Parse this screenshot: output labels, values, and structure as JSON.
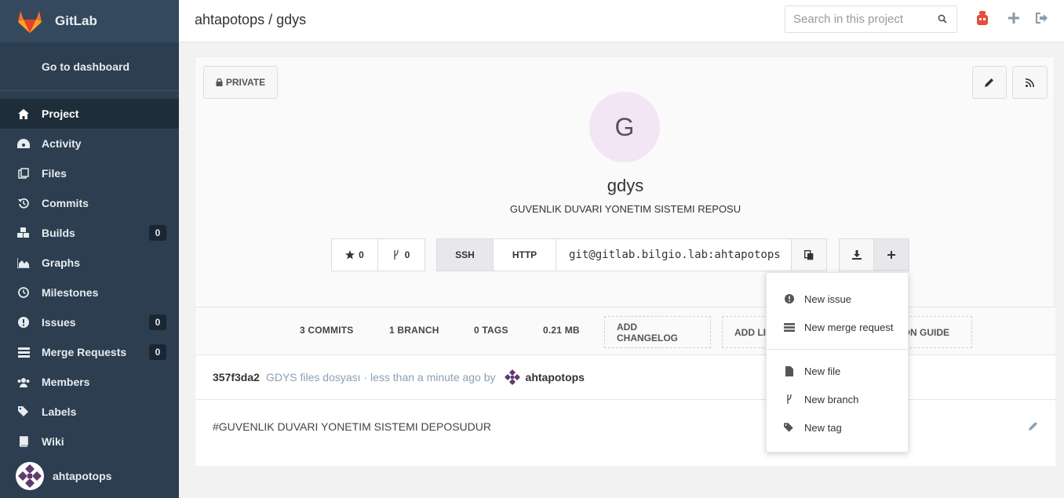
{
  "colors": {
    "sidebar": "#2c3e50",
    "sidebar_header": "#34495e",
    "active_nav": "#1f2d3a",
    "gitlab_orange": "#e24329",
    "header_icon_red": "#e74c3c",
    "avatar_bg": "#f3e5f5"
  },
  "app": {
    "brand": "GitLab",
    "dashboard_link": "Go to dashboard"
  },
  "sidebar": {
    "items": [
      {
        "label": "Project",
        "icon": "home-icon"
      },
      {
        "label": "Activity",
        "icon": "dashboard-icon"
      },
      {
        "label": "Files",
        "icon": "files-icon"
      },
      {
        "label": "Commits",
        "icon": "history-icon"
      },
      {
        "label": "Builds",
        "icon": "cubes-icon",
        "badge": "0"
      },
      {
        "label": "Graphs",
        "icon": "area-chart-icon"
      },
      {
        "label": "Milestones",
        "icon": "clock-icon"
      },
      {
        "label": "Issues",
        "icon": "exclamation-circle-icon",
        "badge": "0"
      },
      {
        "label": "Merge Requests",
        "icon": "tasks-icon",
        "badge": "0"
      },
      {
        "label": "Members",
        "icon": "users-icon"
      },
      {
        "label": "Labels",
        "icon": "tags-icon"
      },
      {
        "label": "Wiki",
        "icon": "book-icon"
      }
    ],
    "user": "ahtapotops"
  },
  "header": {
    "breadcrumb": "ahtapotops / gdys",
    "search_placeholder": "Search in this project"
  },
  "project": {
    "visibility": "PRIVATE",
    "avatar_letter": "G",
    "name": "gdys",
    "description": "GUVENLIK DUVARI YONETIM SISTEMI REPOSU",
    "stars": "0",
    "forks": "0",
    "ssh_label": "SSH",
    "http_label": "HTTP",
    "clone_url": "git@gitlab.bilgio.lab:ahtapotops"
  },
  "stats": {
    "commits": "3 COMMITS",
    "branches": "1 BRANCH",
    "tags": "0 TAGS",
    "size": "0.21 MB",
    "changelog": "ADD CHANGELOG",
    "license": "ADD LI",
    "contrib": "TION GUIDE"
  },
  "last_commit": {
    "sha": "357f3da2",
    "message": "GDYS files dosyası · less than a minute ago by",
    "author": "ahtapotops"
  },
  "readme": "#GUVENLIK DUVARI YONETIM SISTEMI DEPOSUDUR",
  "dropdown": {
    "items": [
      {
        "label": "New issue",
        "icon": "exclamation-circle-icon"
      },
      {
        "label": "New merge request",
        "icon": "tasks-icon"
      },
      {
        "label": "New file",
        "icon": "file-icon"
      },
      {
        "label": "New branch",
        "icon": "code-fork-icon"
      },
      {
        "label": "New tag",
        "icon": "tags-icon"
      }
    ]
  }
}
